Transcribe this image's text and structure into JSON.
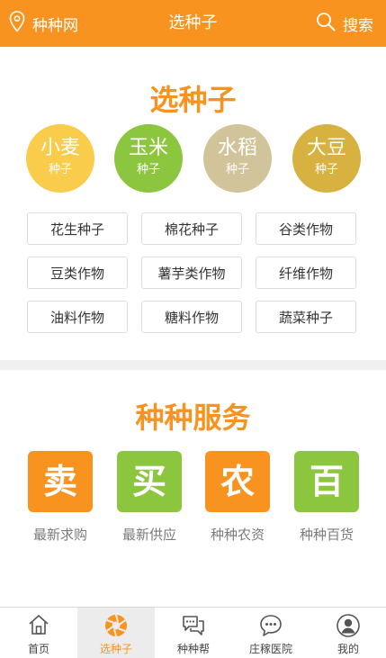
{
  "header": {
    "location": "种种网",
    "title": "选种子",
    "search": "搜索"
  },
  "seeds": {
    "title": "选种子",
    "featured": [
      {
        "name": "小麦",
        "sub": "种子",
        "color": "#f9cc4c"
      },
      {
        "name": "玉米",
        "sub": "种子",
        "color": "#8cc63e"
      },
      {
        "name": "水稻",
        "sub": "种子",
        "color": "#d2c49a"
      },
      {
        "name": "大豆",
        "sub": "种子",
        "color": "#d7b240"
      }
    ],
    "categories": [
      "花生种子",
      "棉花种子",
      "谷类作物",
      "豆类作物",
      "薯芋类作物",
      "纤维作物",
      "油料作物",
      "糖料作物",
      "蔬菜种子"
    ]
  },
  "services": {
    "title": "种种服务",
    "items": [
      {
        "icon": "卖",
        "label": "最新求购",
        "color": "#f7931e"
      },
      {
        "icon": "买",
        "label": "最新供应",
        "color": "#8cc63e"
      },
      {
        "icon": "农",
        "label": "种种农资",
        "color": "#f7931e"
      },
      {
        "icon": "百",
        "label": "种种百货",
        "color": "#8cc63e"
      }
    ]
  },
  "tabs": [
    {
      "label": "首页",
      "icon": "home-icon"
    },
    {
      "label": "选种子",
      "icon": "seed-aperture-icon",
      "active": true
    },
    {
      "label": "种种帮",
      "icon": "chat-icon"
    },
    {
      "label": "庄稼医院",
      "icon": "message-bubble-icon"
    },
    {
      "label": "我的",
      "icon": "user-icon"
    }
  ],
  "colors": {
    "brand": "#f7931e",
    "green": "#8cc63e"
  }
}
